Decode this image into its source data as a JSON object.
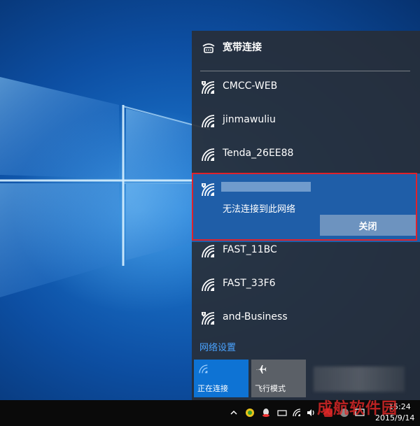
{
  "flyout": {
    "broadband": {
      "label": "宽带连接",
      "icon": "dialup-icon"
    },
    "networks": [
      {
        "ssid": "CMCC-WEB",
        "icon": "wifi-secured-warning-icon"
      },
      {
        "ssid": "jinmawuliu",
        "icon": "wifi-icon"
      },
      {
        "ssid": "Tenda_26EE88",
        "icon": "wifi-icon"
      }
    ],
    "expanded_network": {
      "status": "无法连接到此网络",
      "close_label": "关闭",
      "icon": "wifi-warning-icon"
    },
    "networks_after": [
      {
        "ssid": "FAST_11BC",
        "icon": "wifi-icon"
      },
      {
        "ssid": "FAST_33F6",
        "icon": "wifi-icon"
      },
      {
        "ssid": "and-Business",
        "icon": "wifi-warning-icon"
      }
    ],
    "settings_link": "网络设置",
    "tiles": [
      {
        "label": "正在连接",
        "icon": "wifi-icon",
        "active": true
      },
      {
        "label": "飞行模式",
        "icon": "airplane-icon",
        "active": false
      }
    ]
  },
  "taskbar": {
    "time": "15:24",
    "date": "2015/9/14"
  },
  "watermark": "成航软件园",
  "colors": {
    "accent": "#0e73d4",
    "expanded_bg": "#1f5ea8",
    "highlight": "#e0222b",
    "link": "#4aa3ff"
  }
}
